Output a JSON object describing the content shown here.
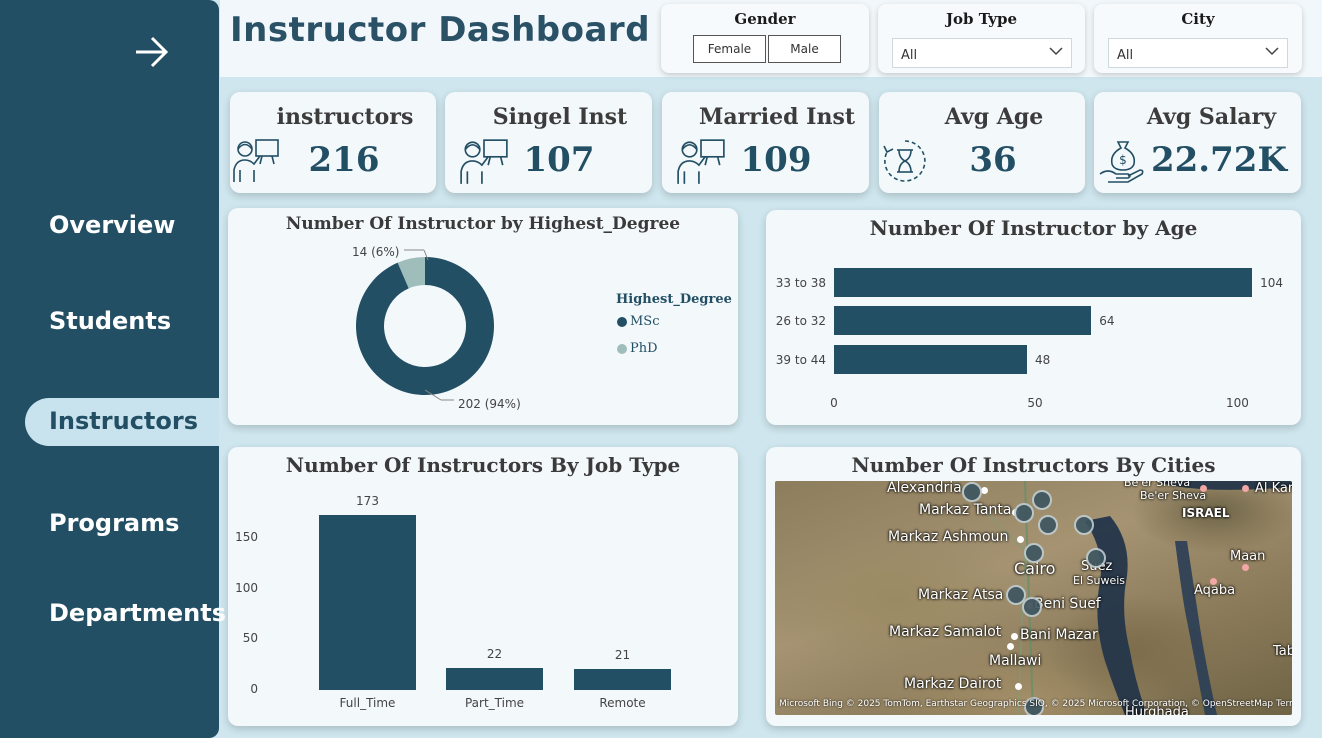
{
  "sidebar": {
    "items": [
      {
        "label": "Overview"
      },
      {
        "label": "Students"
      },
      {
        "label": "Instructors"
      },
      {
        "label": "Programs"
      },
      {
        "label": "Departments"
      }
    ],
    "active": "Instructors"
  },
  "header": {
    "title": "Instructor Dashboard"
  },
  "filters": {
    "gender": {
      "label": "Gender",
      "options": [
        "Female",
        "Male"
      ]
    },
    "job_type": {
      "label": "Job Type",
      "value": "All"
    },
    "city": {
      "label": "City",
      "value": "All"
    }
  },
  "kpis": [
    {
      "label": "instructors",
      "value": "216",
      "icon": "teacher-board-icon"
    },
    {
      "label": "Singel Inst",
      "value": "107",
      "icon": "teacher-board-icon"
    },
    {
      "label": "Married Inst",
      "value": "109",
      "icon": "teacher-board-icon"
    },
    {
      "label": "Avg Age",
      "value": "36",
      "icon": "hourglass-icon"
    },
    {
      "label": "Avg Salary",
      "value": "22.72K",
      "icon": "money-bag-hand-icon"
    }
  ],
  "colors": {
    "primary": "#234f64",
    "secondary": "#9fbdbb",
    "background": "#cfe6ee"
  },
  "chart_data": [
    {
      "type": "pie",
      "title": "Number Of Instructor by Highest_Degree",
      "legend_title": "Highest_Degree",
      "legend_position": "right",
      "categories": [
        "MSc",
        "PhD"
      ],
      "values": [
        202,
        14
      ],
      "data_labels": [
        "202 (94%)",
        "14 (6%)"
      ]
    },
    {
      "type": "bar",
      "orientation": "horizontal",
      "title": "Number Of Instructor by Age",
      "categories": [
        "33 to 38",
        "26 to 32",
        "39 to 44"
      ],
      "values": [
        104,
        64,
        48
      ],
      "xticks": [
        "0",
        "50",
        "100"
      ],
      "xlim": [
        0,
        110
      ],
      "grid": false
    },
    {
      "type": "bar",
      "title": "Number Of Instructors By Job Type",
      "categories": [
        "Full_Time",
        "Part_Time",
        "Remote"
      ],
      "values": [
        173,
        22,
        21
      ],
      "yticks": [
        "0",
        "50",
        "100",
        "150"
      ],
      "ylim": [
        0,
        180
      ],
      "grid": false
    }
  ],
  "map": {
    "title": "Number Of Instructors By Cities",
    "labels": [
      "Alexandria",
      "Markaz Tanta",
      "Markaz Ashmoun",
      "Cairo",
      "Suez",
      "El Suweis",
      "Markaz Atsa",
      "Beni Suef",
      "Markaz Samalot",
      "Bani Mazar",
      "Mallawi",
      "Markaz Dairot",
      "Be'er Sheva",
      "Be'er Sheva",
      "ISRAEL",
      "Maan",
      "Aqaba",
      "Al Kara",
      "Tab",
      "Hurghada"
    ],
    "attribution": "Microsoft Bing  © 2025 TomTom, Earthstar Geographics SIO, © 2025 Microsoft Corporation, © OpenStreetMap  Terms"
  }
}
